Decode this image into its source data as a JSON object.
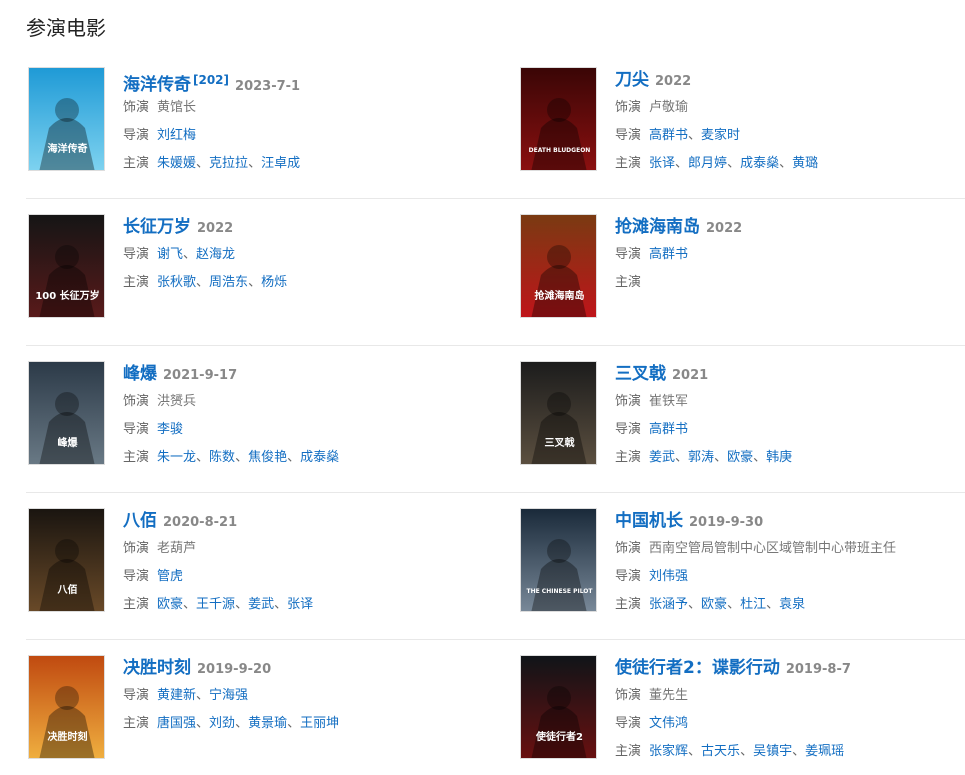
{
  "section_title": "参演电影",
  "labels": {
    "role": "饰演",
    "director": "导演",
    "cast": "主演",
    "sep": "、"
  },
  "colors": {
    "link": "#136ec2",
    "label": "#666666",
    "date": "#888888",
    "divider": "#e8e8e8"
  },
  "movies": [
    {
      "title": "海洋传奇",
      "sup": "[202]",
      "date": "2023-7-1",
      "role": "黄馆长",
      "director": [
        "刘红梅"
      ],
      "cast": [
        "朱媛媛",
        "克拉拉",
        "汪卓成"
      ],
      "poster_text": "海洋传奇",
      "poster_colors": [
        "#1f9ad6",
        "#7fd3f0"
      ]
    },
    {
      "title": "刀尖",
      "date": "2022",
      "role": "卢敬瑜",
      "director": [
        "高群书",
        "麦家时"
      ],
      "cast": [
        "张译",
        "郎月婷",
        "成泰燊",
        "黄璐"
      ],
      "poster_text": "DEATH BLUDGEON",
      "poster_colors": [
        "#3a0606",
        "#8c1010"
      ]
    },
    {
      "title": "长征万岁",
      "date": "2022",
      "director": [
        "谢飞",
        "赵海龙"
      ],
      "cast": [
        "张秋歌",
        "周浩东",
        "杨烁"
      ],
      "poster_text": "100 长征万岁",
      "poster_colors": [
        "#151515",
        "#5a1a1a"
      ]
    },
    {
      "title": "抢滩海南岛",
      "date": "2022",
      "director": [
        "高群书"
      ],
      "cast": [],
      "poster_text": "抢滩海南岛",
      "poster_colors": [
        "#7a3a12",
        "#c0141a"
      ]
    },
    {
      "title": "峰爆",
      "date": "2021-9-17",
      "role": "洪赟兵",
      "director": [
        "李骏"
      ],
      "cast": [
        "朱一龙",
        "陈数",
        "焦俊艳",
        "成泰燊"
      ],
      "poster_text": "峰爆",
      "poster_colors": [
        "#2c3a48",
        "#6a7a86"
      ]
    },
    {
      "title": "三叉戟",
      "date": "2021",
      "role": "崔铁军",
      "director": [
        "高群书"
      ],
      "cast": [
        "姜武",
        "郭涛",
        "欧豪",
        "韩庚"
      ],
      "poster_text": "三叉戟",
      "poster_colors": [
        "#1c1c1c",
        "#5c5040"
      ]
    },
    {
      "title": "八佰",
      "date": "2020-8-21",
      "role": "老葫芦",
      "director": [
        "管虎"
      ],
      "cast": [
        "欧豪",
        "王千源",
        "姜武",
        "张译"
      ],
      "poster_text": "八佰",
      "poster_colors": [
        "#1a1510",
        "#6a4a28"
      ]
    },
    {
      "title": "中国机长",
      "date": "2019-9-30",
      "role": "西南空管局管制中心区域管制中心带班主任",
      "director": [
        "刘伟强"
      ],
      "cast": [
        "张涵予",
        "欧豪",
        "杜江",
        "袁泉"
      ],
      "poster_text": "THE CHINESE PILOT",
      "poster_colors": [
        "#1a2a3a",
        "#7a8a9a"
      ]
    },
    {
      "title": "决胜时刻",
      "date": "2019-9-20",
      "director": [
        "黄建新",
        "宁海强"
      ],
      "cast": [
        "唐国强",
        "刘劲",
        "黄景瑜",
        "王丽坤"
      ],
      "poster_text": "决胜时刻",
      "poster_colors": [
        "#c04a10",
        "#f0b040"
      ]
    },
    {
      "title": "使徒行者2：谍影行动",
      "date": "2019-8-7",
      "role": "董先生",
      "director": [
        "文伟鸿"
      ],
      "cast": [
        "张家辉",
        "古天乐",
        "吴镇宇",
        "姜珮瑶"
      ],
      "poster_text": "使徒行者2",
      "poster_colors": [
        "#101418",
        "#6a1010"
      ]
    }
  ]
}
